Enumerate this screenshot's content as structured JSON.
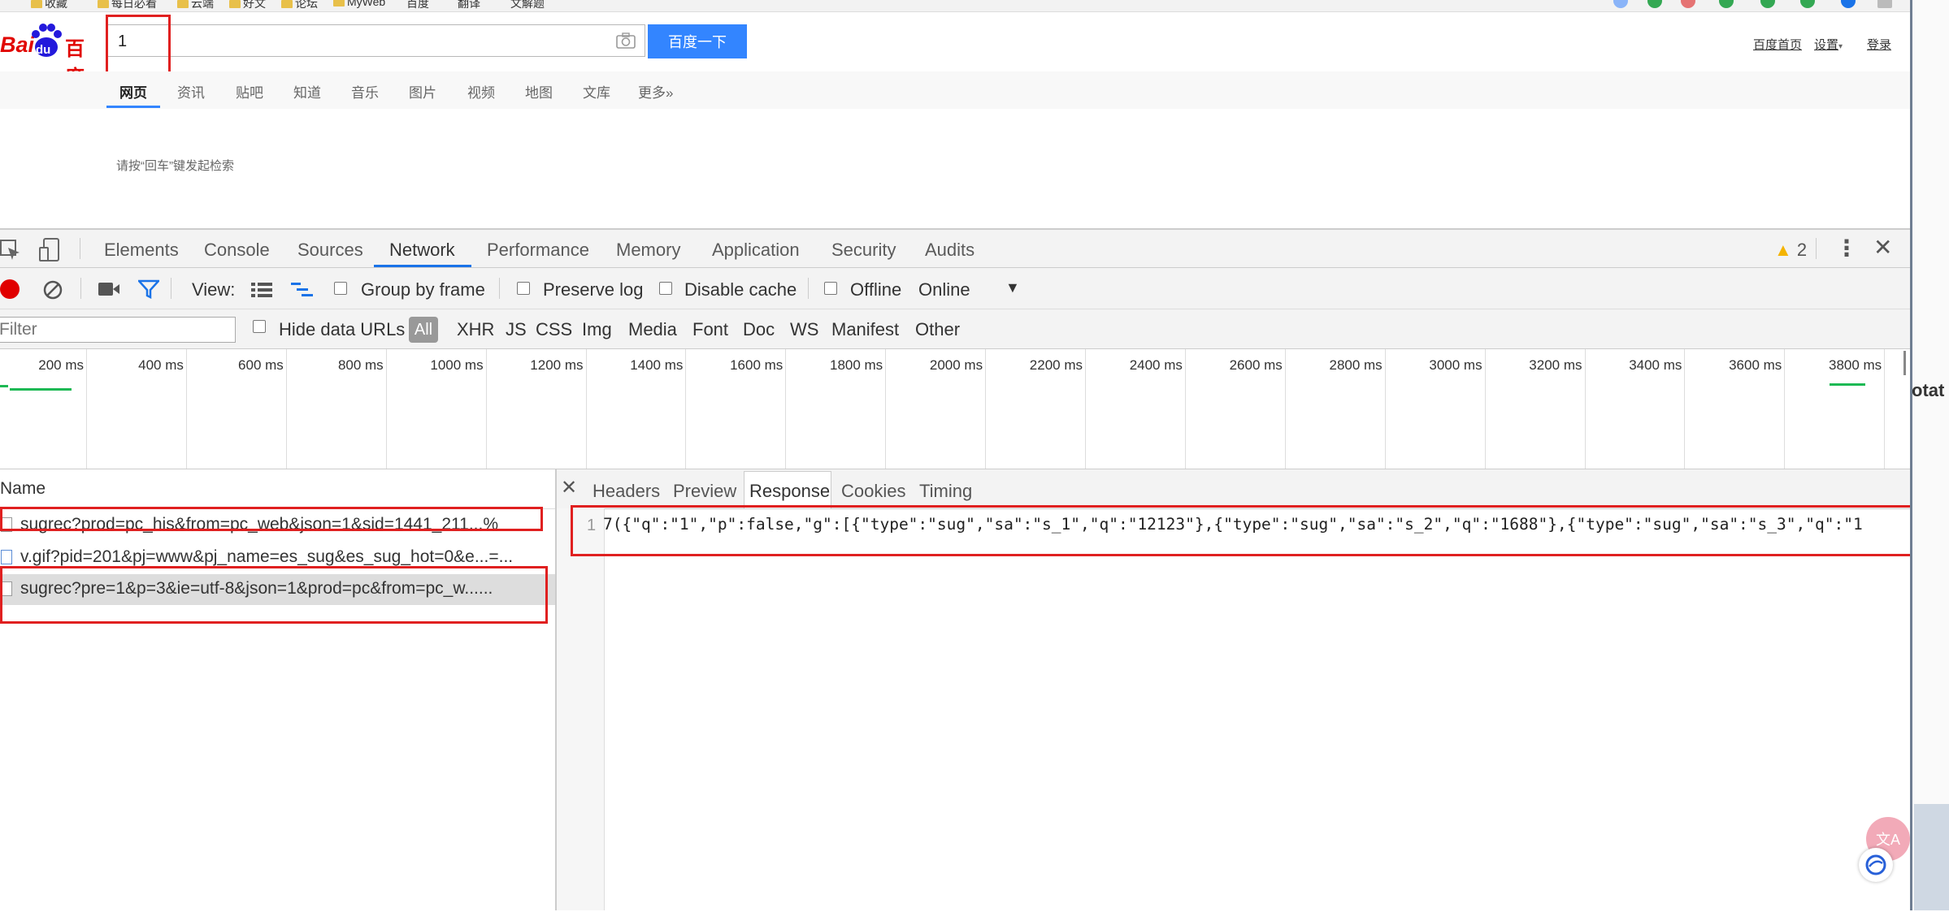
{
  "bookmarks": {
    "items": [
      "收藏",
      "每日必看",
      "云端",
      "好文",
      "论坛",
      "MyWeb",
      "百度",
      "翻译",
      "文解题"
    ]
  },
  "baidu": {
    "logo_text": "Bai",
    "logo_du": "du",
    "logo_cn": "百度",
    "search_value": "1",
    "search_button": "百度一下",
    "top_links": [
      "百度首页",
      "设置",
      "登录"
    ],
    "tabs": [
      "网页",
      "资讯",
      "贴吧",
      "知道",
      "音乐",
      "图片",
      "视频",
      "地图",
      "文库",
      "更多»"
    ],
    "hint": "请按“回车”键发起检索"
  },
  "devtools": {
    "tabs": [
      "Elements",
      "Console",
      "Sources",
      "Network",
      "Performance",
      "Memory",
      "Application",
      "Security",
      "Audits"
    ],
    "warning_count": "2",
    "toolbar": {
      "view_label": "View:",
      "group_by_frame": "Group by frame",
      "preserve_log": "Preserve log",
      "disable_cache": "Disable cache",
      "offline": "Offline",
      "online": "Online"
    },
    "filterbar": {
      "filter_placeholder": "Filter",
      "hide_data_urls": "Hide data URLs",
      "types": [
        "All",
        "XHR",
        "JS",
        "CSS",
        "Img",
        "Media",
        "Font",
        "Doc",
        "WS",
        "Manifest",
        "Other"
      ]
    },
    "timeline_ticks": [
      "200 ms",
      "400 ms",
      "600 ms",
      "800 ms",
      "1000 ms",
      "1200 ms",
      "1400 ms",
      "1600 ms",
      "1800 ms",
      "2000 ms",
      "2200 ms",
      "2400 ms",
      "2600 ms",
      "2800 ms",
      "3000 ms",
      "3200 ms",
      "3400 ms",
      "3600 ms",
      "3800 ms"
    ],
    "requests": {
      "header": "Name",
      "rows": [
        "sugrec?prod=pc_his&from=pc_web&json=1&sid=1441_211...%",
        "v.gif?pid=201&pj=www&pj_name=es_sug&es_sug_hot=0&e...=...",
        "sugrec?pre=1&p=3&ie=utf-8&json=1&prod=pc&from=pc_w......"
      ]
    },
    "response": {
      "tabs": [
        "Headers",
        "Preview",
        "Response",
        "Cookies",
        "Timing"
      ],
      "line_number": "1",
      "code": "7({\"q\":\"1\",\"p\":false,\"g\":[{\"type\":\"sug\",\"sa\":\"s_1\",\"q\":\"12123\"},{\"type\":\"sug\",\"sa\":\"s_2\",\"q\":\"1688\"},{\"type\":\"sug\",\"sa\":\"s_3\",\"q\":\"1"
    }
  },
  "side": {
    "text": "otat",
    "translate_label": "文A"
  }
}
